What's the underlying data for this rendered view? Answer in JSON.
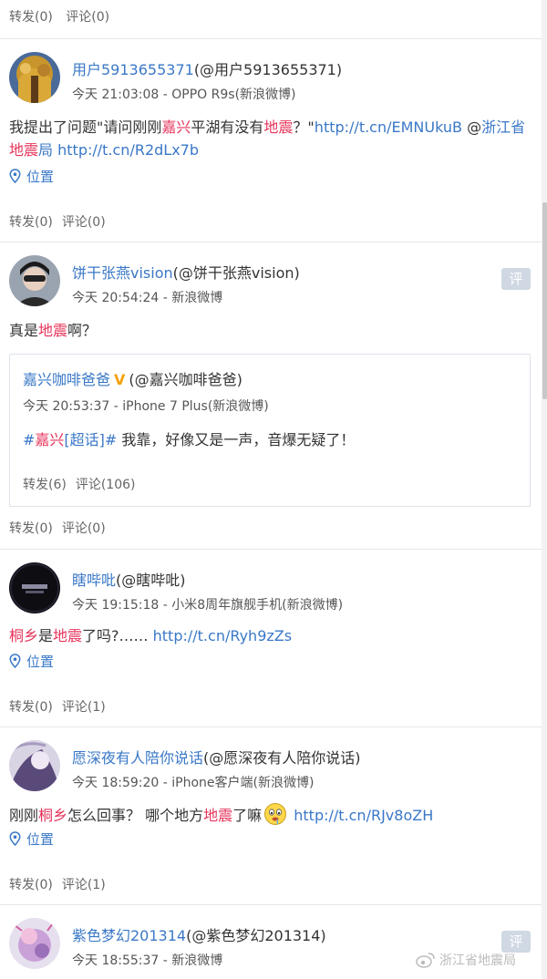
{
  "top": {
    "repost": "转发(0)",
    "comment": "评论(0)"
  },
  "posts": [
    {
      "name": "用户5913655371",
      "handle": "(@用户5913655371)",
      "meta": "今天 21:03:08 - OPPO R9s(新浪微博)",
      "content": [
        {
          "t": "我提出了问题\"请问刚刚"
        },
        {
          "t": "嘉兴",
          "c": "hl"
        },
        {
          "t": "平湖有没有"
        },
        {
          "t": "地震",
          "c": "hl"
        },
        {
          "t": "？\""
        },
        {
          "t": "http://t.cn/EMNUkuB",
          "c": "lk"
        },
        {
          "t": " @"
        },
        {
          "t": "浙江省",
          "c": "lk"
        },
        {
          "t": "地震",
          "c": "hl"
        },
        {
          "t": "局",
          "c": "lk"
        },
        {
          "t": " "
        },
        {
          "t": "http://t.cn/R2dLx7b",
          "c": "lk"
        }
      ],
      "location": "位置",
      "repost": "转发(0)",
      "comment": "评论(0)"
    },
    {
      "name": "饼干张燕vision",
      "handle": "(@饼干张燕vision)",
      "meta": "今天 20:54:24 - 新浪微博",
      "ping": "评",
      "content": [
        {
          "t": "真是"
        },
        {
          "t": "地震",
          "c": "hl"
        },
        {
          "t": "啊？"
        }
      ],
      "quote": {
        "name": "嘉兴咖啡爸爸",
        "verified": "V",
        "handle": "(@嘉兴咖啡爸爸)",
        "meta": "今天 20:53:37 - iPhone 7 Plus(新浪微博)",
        "content": [
          {
            "t": "#",
            "c": "lk"
          },
          {
            "t": "嘉兴",
            "c": "hl"
          },
          {
            "t": "[超话]#",
            "c": "lk"
          },
          {
            "t": " 我靠，好像又是一声，音爆无疑了！"
          }
        ],
        "repost": "转发(6)",
        "comment": "评论(106)"
      },
      "repost": "转发(0)",
      "comment": "评论(0)"
    },
    {
      "name": "瞎哔吡",
      "handle": "(@瞎哔吡)",
      "meta": "今天 19:15:18 - 小米8周年旗舰手机(新浪微博)",
      "content": [
        {
          "t": "桐乡",
          "c": "hl"
        },
        {
          "t": "是"
        },
        {
          "t": "地震",
          "c": "hl"
        },
        {
          "t": "了吗?……  "
        },
        {
          "t": "http://t.cn/Ryh9zZs",
          "c": "lk"
        }
      ],
      "location": "位置",
      "repost": "转发(0)",
      "comment": "评论(1)"
    },
    {
      "name": "愿深夜有人陪你说话",
      "handle": "(@愿深夜有人陪你说话)",
      "meta": "今天 18:59:20 - iPhone客户端(新浪微博)",
      "content": [
        {
          "t": "刚刚"
        },
        {
          "t": "桐乡",
          "c": "hl"
        },
        {
          "t": "怎么回事？ 哪个地方"
        },
        {
          "t": "地震",
          "c": "hl"
        },
        {
          "t": "了嘛"
        },
        {
          "emoji": true
        },
        {
          "t": "  "
        },
        {
          "t": "http://t.cn/RJv8oZH",
          "c": "lk"
        }
      ],
      "location": "位置",
      "repost": "转发(0)",
      "comment": "评论(1)"
    },
    {
      "name": "紫色梦幻201314",
      "handle": "(@紫色梦幻201314)",
      "meta": "今天 18:55:37 - 新浪微博",
      "ping": "评"
    }
  ],
  "watermark": "浙江省地震局",
  "colors": {
    "link": "#3a78c7",
    "highlight": "#e6345b",
    "meta": "#555555",
    "verified": "#f4a00a"
  },
  "icons": {
    "location": "location-pin-icon",
    "verified": "verified-v-icon",
    "emoji": "drool-face-emoji-icon",
    "watermark": "weibo-logo-icon"
  }
}
